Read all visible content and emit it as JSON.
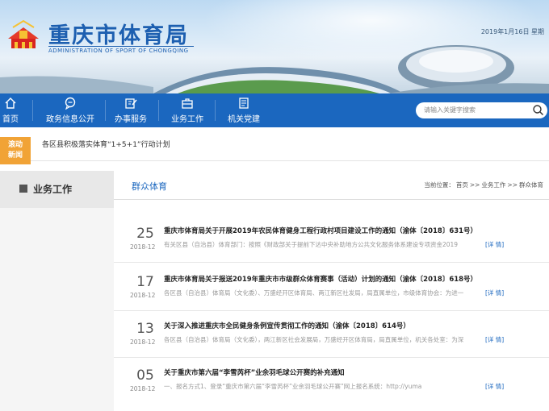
{
  "header": {
    "title_cn": "重庆市体育局",
    "title_en": "ADMINISTRATION OF SPORT OF CHONGQING",
    "date": "2019年1月16日  星期"
  },
  "nav": {
    "items": [
      {
        "label": "首页",
        "icon": "home-icon"
      },
      {
        "label": "政务信息公开",
        "icon": "chat-icon"
      },
      {
        "label": "办事服务",
        "icon": "edit-icon"
      },
      {
        "label": "业务工作",
        "icon": "briefcase-icon"
      },
      {
        "label": "机关党建",
        "icon": "book-icon"
      }
    ],
    "search_placeholder": "请输入关键字搜索"
  },
  "ticker": {
    "badge_line1": "滚动",
    "badge_line2": "新闻",
    "text": "各区县积极落实体育“1+5+1”行动计划"
  },
  "sidebar": {
    "title": "业务工作"
  },
  "main": {
    "section_title": "群众体育",
    "breadcrumb": {
      "prefix": "当前位置：",
      "items": [
        "首页",
        "业务工作",
        "群众体育"
      ],
      "sep": ">>"
    },
    "articles": [
      {
        "day": "25",
        "ym": "2018-12",
        "title": "重庆市体育局关于开展2019年农民体育健身工程行政村项目建设工作的通知（渝体〔2018〕631号）",
        "desc": "有关区县（自治县）体育部门：按照《财政部关于提前下达中央补助地方公共文化服务体系建设专项资金2019",
        "more": "[详 情]"
      },
      {
        "day": "17",
        "ym": "2018-12",
        "title": "重庆市体育局关于报送2019年重庆市市级群众体育赛事（活动）计划的通知（渝体〔2018〕618号）",
        "desc": "各区县（自治县）体育局（文化委）、万盛经开区体育局、两江新区社发局，局直属单位，市级体育协会：为进一",
        "more": "[详 情]"
      },
      {
        "day": "13",
        "ym": "2018-12",
        "title": "关于深入推进重庆市全民健身条例宣传贯彻工作的通知（渝体〔2018〕614号）",
        "desc": "各区县（自治县）体育局（文化委），两江新区社会发展局，万盛经开区体育局，局直属单位，机关各处室：为深",
        "more": "[详 情]"
      },
      {
        "day": "05",
        "ym": "2018-12",
        "title": "关于重庆市第六届“李雪芮杯”业余羽毛球公开赛的补充通知",
        "desc": "一、报名方式1、登录“重庆市第六届“李雪芮杯”业余羽毛球公开赛”网上报名系统：http://yuma",
        "more": "[详 情]"
      }
    ]
  }
}
